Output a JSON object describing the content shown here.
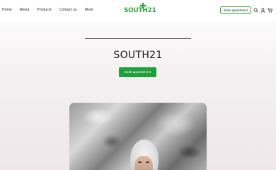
{
  "nav": {
    "items": [
      {
        "label": "Home"
      },
      {
        "label": "About"
      },
      {
        "label": "Products"
      },
      {
        "label": "Contact us"
      },
      {
        "label": "More"
      }
    ]
  },
  "brand": {
    "logo_text": "SOUTH21",
    "accent": "#2eaa3a"
  },
  "header": {
    "book_label": "Book appointment"
  },
  "icons": [
    "search-icon",
    "user-icon",
    "cart-icon"
  ],
  "hero": {
    "title": "SOUTH21",
    "button_label": "Book appointment",
    "button_color": "#1fa03a"
  }
}
